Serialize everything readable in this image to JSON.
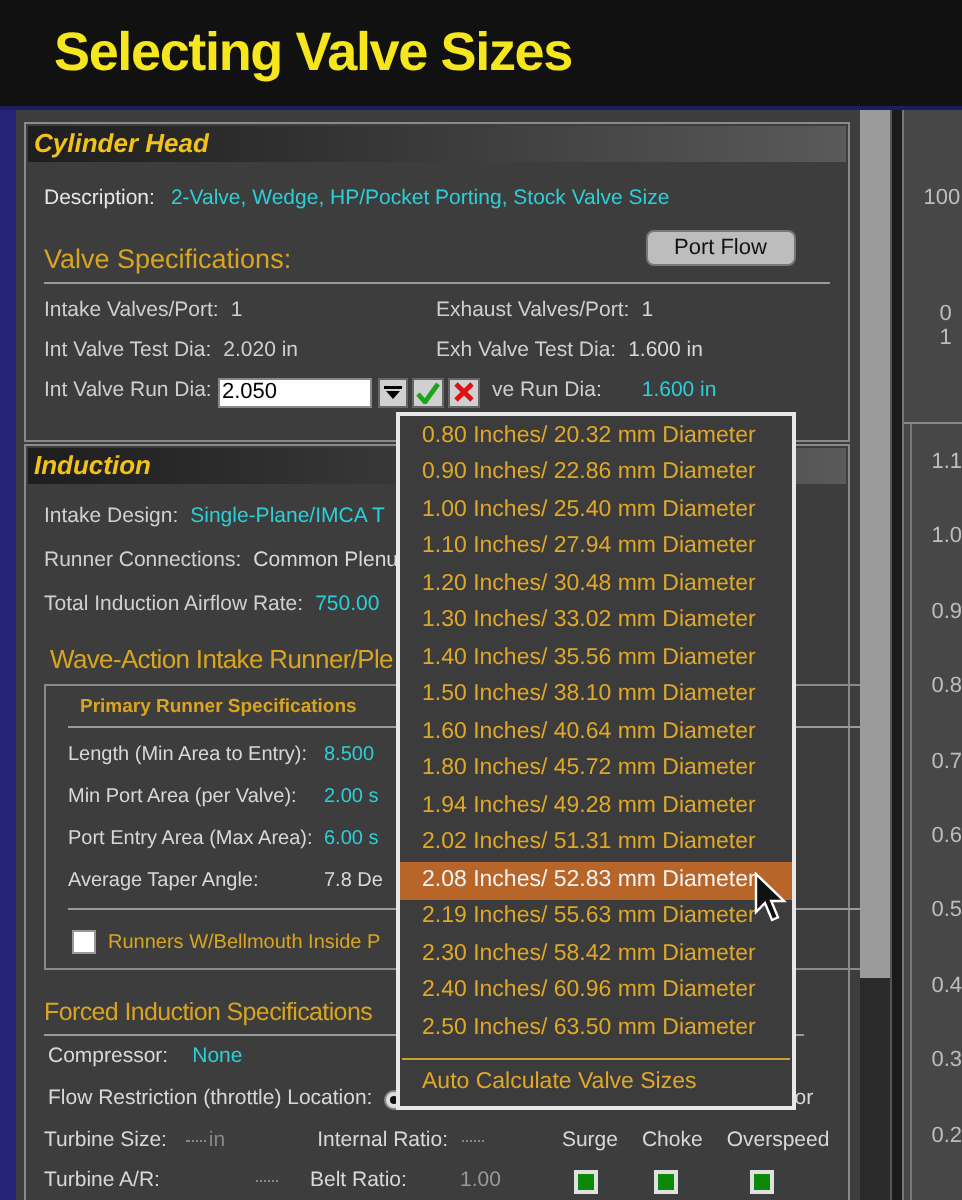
{
  "title": "Selecting Valve Sizes",
  "cylinder_head": {
    "heading": "Cylinder Head",
    "description": {
      "label": "Description:",
      "value": "2-Valve, Wedge, HP/Pocket Porting, Stock Valve Size"
    },
    "port_flow_button": "Port Flow",
    "valve_heading": "Valve Specifications:",
    "rows": [
      {
        "left": {
          "label": "Intake Valves/Port:",
          "value": "1"
        },
        "right": {
          "label": "Exhaust Valves/Port:",
          "value": "1",
          "emphasis": false
        }
      },
      {
        "left": {
          "label": "Int Valve Test Dia:",
          "value": "2.020 in"
        },
        "right": {
          "label": "Exh Valve Test Dia:",
          "value": "1.600 in",
          "emphasis": false
        }
      }
    ],
    "run_row": {
      "label": "Int Valve Run Dia:",
      "input": "2.050",
      "right": {
        "label": "ve Run Dia:",
        "value": "1.600 in",
        "emphasis": true
      }
    }
  },
  "induction": {
    "heading": "Induction",
    "fields": [
      {
        "label": "Intake Design:",
        "value": "Single-Plane/IMCA T",
        "emphasis": true
      },
      {
        "label": "Runner Connections:",
        "value": "Common Plenu",
        "emphasis": false
      },
      {
        "label": "Total Induction Airflow Rate:",
        "value": "750.00",
        "emphasis": true
      }
    ],
    "wave_heading": "Wave-Action Intake Runner/Ple",
    "primary": {
      "heading": "Primary Runner Specifications",
      "fields": [
        {
          "label": "Length (Min Area to Entry):",
          "value": "8.500",
          "emphasis": true
        },
        {
          "label": "Min Port Area (per Valve):",
          "value": "2.00 s",
          "emphasis": true
        },
        {
          "label": "Port Entry Area (Max Area):",
          "value": "6.00 s",
          "emphasis": true
        },
        {
          "label": "Average Taper Angle:",
          "value": "7.8 De",
          "emphasis": false
        }
      ]
    },
    "bellmouth": {
      "label": "Runners W/Bellmouth Inside P",
      "checked": false
    }
  },
  "forced": {
    "heading": "Forced Induction Specifications",
    "compressor": {
      "label": "Compressor:",
      "value": "None"
    },
    "flow_restriction": {
      "label": "Flow Restriction (throttle) Location:",
      "trailing": "or",
      "selected": true
    },
    "turbine_size": {
      "label": "Turbine Size:",
      "unit": "in"
    },
    "internal_ratio": {
      "label": "Internal Ratio:"
    },
    "turbine_ar": {
      "label": "Turbine A/R:"
    },
    "belt_ratio": {
      "label": "Belt Ratio:",
      "value": "1.00"
    },
    "indicators": [
      {
        "label": "Surge",
        "on": true
      },
      {
        "label": "Choke",
        "on": true
      },
      {
        "label": "Overspeed",
        "on": true
      }
    ]
  },
  "dropdown": {
    "options": [
      {
        "label": "0.80 Inches/ 20.32 mm Diameter",
        "selected": false
      },
      {
        "label": "0.90 Inches/ 22.86 mm Diameter",
        "selected": false
      },
      {
        "label": "1.00 Inches/ 25.40 mm Diameter",
        "selected": false
      },
      {
        "label": "1.10 Inches/ 27.94 mm Diameter",
        "selected": false
      },
      {
        "label": "1.20 Inches/ 30.48 mm Diameter",
        "selected": false
      },
      {
        "label": "1.30 Inches/ 33.02 mm Diameter",
        "selected": false
      },
      {
        "label": "1.40 Inches/ 35.56 mm Diameter",
        "selected": false
      },
      {
        "label": "1.50 Inches/ 38.10 mm Diameter",
        "selected": false
      },
      {
        "label": "1.60 Inches/ 40.64 mm Diameter",
        "selected": false
      },
      {
        "label": "1.80 Inches/ 45.72 mm Diameter",
        "selected": false
      },
      {
        "label": "1.94 Inches/ 49.28 mm Diameter",
        "selected": false
      },
      {
        "label": "2.02 Inches/ 51.31 mm Diameter",
        "selected": false
      },
      {
        "label": "2.08 Inches/ 52.83 mm Diameter",
        "selected": true
      },
      {
        "label": "2.19 Inches/ 55.63 mm Diameter",
        "selected": false
      },
      {
        "label": "2.30 Inches/ 58.42 mm Diameter",
        "selected": false
      },
      {
        "label": "2.40 Inches/ 60.96 mm Diameter",
        "selected": false
      },
      {
        "label": "2.50 Inches/ 63.50 mm Diameter",
        "selected": false
      }
    ],
    "action": "Auto Calculate Valve Sizes"
  },
  "side_panel": {
    "top_labels": [
      "100",
      "0",
      "1"
    ],
    "lower_labels": [
      "1.1",
      "1.0",
      "0.9",
      "0.8",
      "0.7",
      "0.6",
      "0.5",
      "0.4",
      "0.3",
      "0.2"
    ]
  }
}
